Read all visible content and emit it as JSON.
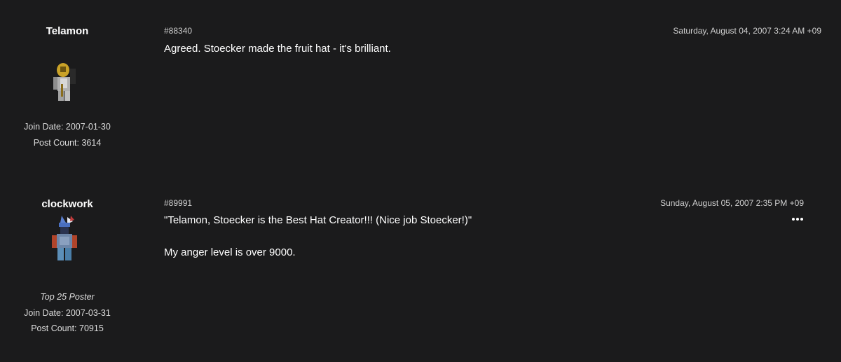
{
  "posts": [
    {
      "author": {
        "name": "Telamon",
        "rank": "",
        "join_date": "Join Date: 2007-01-30",
        "post_count": "Post Count: 3614"
      },
      "post_id": "#88340",
      "date": "Saturday, August 04, 2007 3:24 AM +09",
      "body": [
        "Agreed. Stoecker made the fruit hat - it's brilliant."
      ]
    },
    {
      "author": {
        "name": "clockwork",
        "rank": "Top 25 Poster",
        "join_date": "Join Date: 2007-03-31",
        "post_count": "Post Count: 70915"
      },
      "post_id": "#89991",
      "date": "Sunday, August 05, 2007 2:35 PM +09",
      "body": [
        "\"Telamon, Stoecker is the Best Hat Creator!!! (Nice job Stoecker!)\"",
        "My anger level is over 9000."
      ],
      "more_icon": "ellipsis-icon"
    }
  ]
}
